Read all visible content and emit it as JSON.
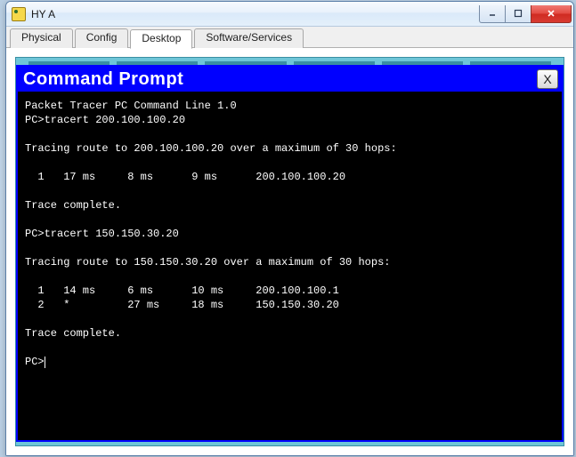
{
  "window": {
    "title": "HY A"
  },
  "tabs": [
    {
      "label": "Physical",
      "active": false
    },
    {
      "label": "Config",
      "active": false
    },
    {
      "label": "Desktop",
      "active": true
    },
    {
      "label": "Software/Services",
      "active": false
    }
  ],
  "cmd": {
    "title": "Command Prompt",
    "close_label": "X",
    "lines": [
      "Packet Tracer PC Command Line 1.0",
      "PC>tracert 200.100.100.20",
      "",
      "Tracing route to 200.100.100.20 over a maximum of 30 hops: ",
      "",
      "  1   17 ms     8 ms      9 ms      200.100.100.20",
      "",
      "Trace complete.",
      "",
      "PC>tracert 150.150.30.20",
      "",
      "Tracing route to 150.150.30.20 over a maximum of 30 hops: ",
      "",
      "  1   14 ms     6 ms      10 ms     200.100.100.1",
      "  2   *         27 ms     18 ms     150.150.30.20",
      "",
      "Trace complete.",
      "",
      "PC>"
    ]
  },
  "win_controls": {
    "min_label": "–",
    "max_label": "□",
    "close_label": "✕"
  }
}
